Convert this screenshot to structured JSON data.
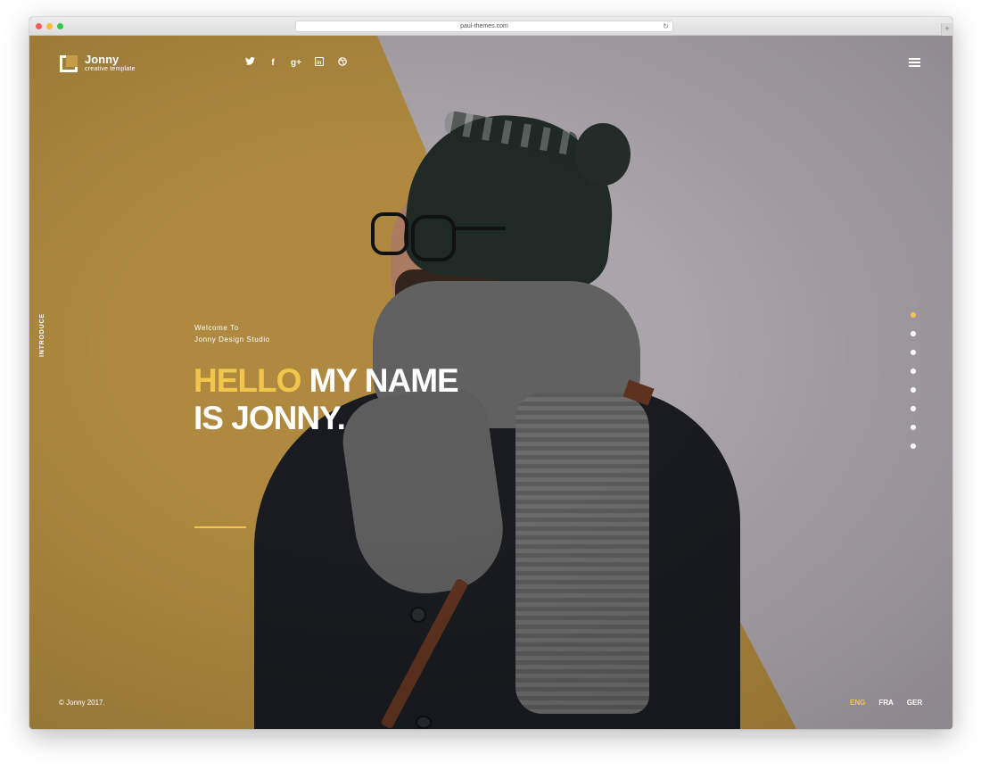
{
  "browser": {
    "url": "paul-themes.com",
    "reload_icon": "reload-icon",
    "new_tab_icon": "plus-icon",
    "new_tab_symbol": "+"
  },
  "site": {
    "logo_title": "Jonny",
    "logo_subtitle": "creative template",
    "social": [
      {
        "name": "twitter-icon",
        "glyph": ""
      },
      {
        "name": "facebook-icon",
        "glyph": "f"
      },
      {
        "name": "google-plus-icon",
        "glyph": "g+"
      },
      {
        "name": "linkedin-icon",
        "glyph": "in"
      },
      {
        "name": "dribbble-icon",
        "glyph": ""
      }
    ],
    "menu_icon": "hamburger-menu-icon",
    "side_label": "INTRODUCE",
    "welcome_line1": "Welcome To",
    "welcome_line2": "Jonny Design Studio",
    "headline_accent": "HELLO",
    "headline_rest": " MY NAME",
    "headline_line2": "IS JONNY.",
    "copyright": "© Jonny 2017.",
    "languages": [
      {
        "label": "ENG",
        "active": true
      },
      {
        "label": "FRA",
        "active": false
      },
      {
        "label": "GER",
        "active": false
      }
    ],
    "pager_count": 8,
    "pager_active_index": 0,
    "colors": {
      "accent": "#f2c64c",
      "wall_yellow": "#c79d48",
      "wall_grey": "#c3bcc1"
    }
  }
}
